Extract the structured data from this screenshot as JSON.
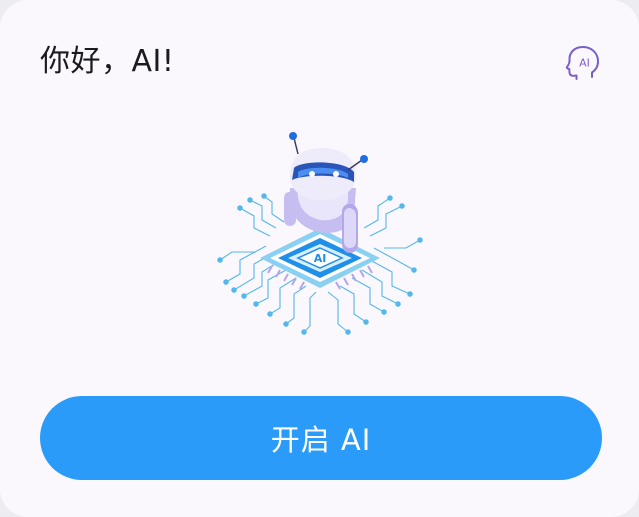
{
  "header": {
    "title": "你好，AI!",
    "ai_icon_text": "AI"
  },
  "illustration": {
    "chip_text": "AI",
    "icon": "robot-on-ai-chip-illustration"
  },
  "action": {
    "start_label": "开启 AI"
  },
  "colors": {
    "accent": "#2a9bf8",
    "icon_purple": "#7a5fc9",
    "background": "#fbf8fd",
    "title_text": "#1b1b1f"
  }
}
